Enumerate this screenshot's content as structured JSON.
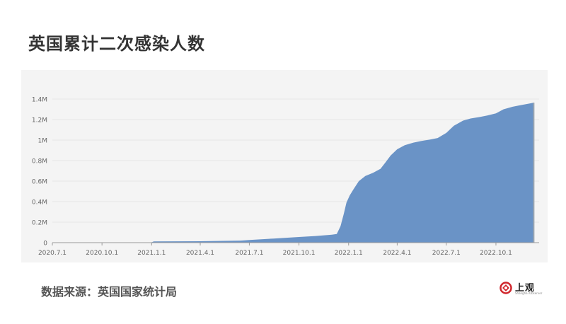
{
  "header": {
    "title": "英国累计二次感染人数"
  },
  "footer": {
    "source": "数据来源：英国国家统计局"
  },
  "logo": {
    "text": "上观",
    "subtext": "Shanghai Observer",
    "color": "#d0262c"
  },
  "colors": {
    "area": "#6a93c6",
    "edge": "#9aa6b2",
    "grid": "#e6e6e6",
    "panel": "#f4f4f4",
    "axis": "#666666"
  },
  "chart_data": {
    "type": "area",
    "title": "英国累计二次感染人数",
    "xlabel": "",
    "ylabel": "",
    "ylim": [
      0,
      1400000
    ],
    "yticks": [
      0,
      200000,
      400000,
      600000,
      800000,
      1000000,
      1200000,
      1400000
    ],
    "ytick_labels": [
      "0",
      "0.2M",
      "0.4M",
      "0.6M",
      "0.8M",
      "1M",
      "1.2M",
      "1.4M"
    ],
    "xticks": [
      "2020-07-01",
      "2020-10-01",
      "2021-01-01",
      "2021-04-01",
      "2021-07-01",
      "2021-10-01",
      "2022-01-01",
      "2022-04-01",
      "2022-07-01",
      "2022-10-01"
    ],
    "xtick_labels": [
      "2020.7.1",
      "2020.10.1",
      "2021.1.1",
      "2021.4.1",
      "2021.7.1",
      "2021.10.1",
      "2022.1.1",
      "2022.4.1",
      "2022.7.1",
      "2022.10.1"
    ],
    "grid": true,
    "series": [
      {
        "x": [
          "2020-07-01",
          "2020-10-01",
          "2020-12-31",
          "2021-01-05",
          "2021-04-01",
          "2021-06-15",
          "2021-07-01",
          "2021-08-15",
          "2021-10-01",
          "2021-11-01",
          "2021-12-01",
          "2021-12-10",
          "2021-12-17",
          "2021-12-23",
          "2021-12-28",
          "2022-01-03",
          "2022-01-10",
          "2022-01-20",
          "2022-02-01",
          "2022-02-15",
          "2022-03-01",
          "2022-03-10",
          "2022-03-20",
          "2022-04-01",
          "2022-04-15",
          "2022-05-01",
          "2022-05-15",
          "2022-06-01",
          "2022-06-15",
          "2022-07-01",
          "2022-07-15",
          "2022-08-01",
          "2022-08-15",
          "2022-09-01",
          "2022-09-15",
          "2022-10-01",
          "2022-10-15",
          "2022-11-01",
          "2022-11-15",
          "2022-12-01",
          "2022-12-10"
        ],
        "y": [
          0,
          1000,
          2000,
          12000,
          14000,
          20000,
          26000,
          40000,
          55000,
          65000,
          78000,
          85000,
          160000,
          280000,
          390000,
          460000,
          520000,
          600000,
          650000,
          680000,
          720000,
          780000,
          850000,
          910000,
          950000,
          975000,
          990000,
          1005000,
          1020000,
          1070000,
          1140000,
          1190000,
          1210000,
          1225000,
          1240000,
          1260000,
          1300000,
          1325000,
          1340000,
          1355000,
          1365000
        ]
      }
    ]
  }
}
